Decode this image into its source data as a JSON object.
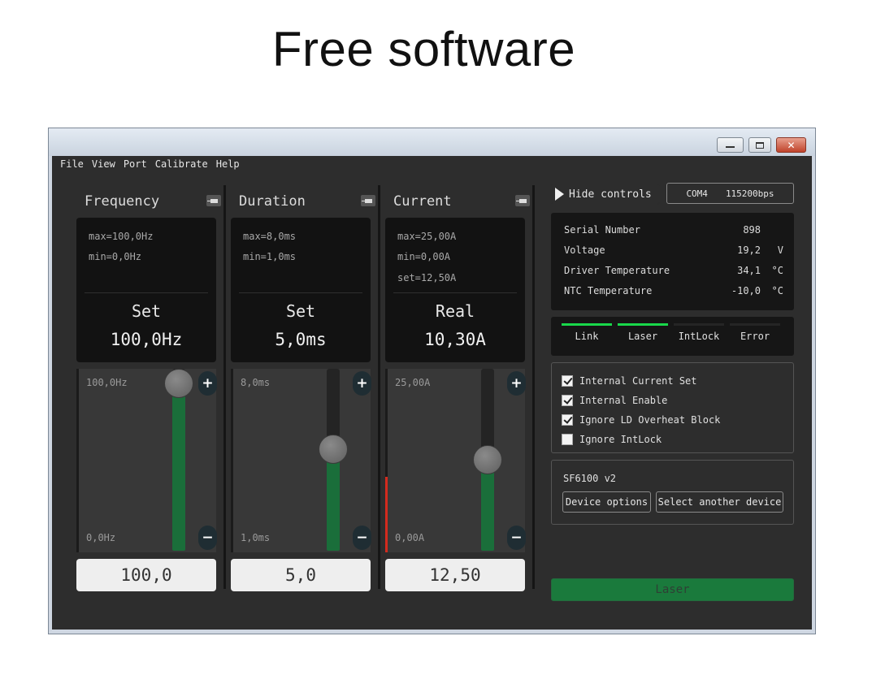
{
  "slide": {
    "title": "Free software"
  },
  "window": {
    "controls": {
      "minimize": "minimize",
      "maximize": "maximize",
      "close": "✕"
    }
  },
  "menu": [
    "File",
    "View",
    "Port",
    "Calibrate",
    "Help"
  ],
  "panels": [
    {
      "title": "Frequency",
      "info": [
        "max=100,0Hz",
        "min=0,0Hz"
      ],
      "mode": "Set",
      "display": "100,0Hz",
      "slider_max": "100,0Hz",
      "slider_min": "0,0Hz",
      "level": 1.0,
      "field": "100,0"
    },
    {
      "title": "Duration",
      "info": [
        "max=8,0ms",
        "min=1,0ms"
      ],
      "mode": "Set",
      "display": "5,0ms",
      "slider_max": "8,0ms",
      "slider_min": "1,0ms",
      "level": 0.571,
      "field": "5,0"
    },
    {
      "title": "Current",
      "info": [
        "max=25,00A",
        "min=0,00A",
        "set=12,50A"
      ],
      "mode": "Real",
      "display": "10,30A",
      "slider_max": "25,00A",
      "slider_min": "0,00A",
      "level": 0.5,
      "actual_level": 0.412,
      "field": "12,50"
    }
  ],
  "controls": {
    "hide_label": "Hide controls",
    "port": "COM4",
    "baud": "115200bps"
  },
  "status": [
    {
      "label": "Serial Number",
      "value": "898",
      "unit": ""
    },
    {
      "label": "Voltage",
      "value": "19,2",
      "unit": "V"
    },
    {
      "label": "Driver Temperature",
      "value": "34,1",
      "unit": "°C"
    },
    {
      "label": "NTC Temperature",
      "value": "-10,0",
      "unit": "°C"
    }
  ],
  "indicators": [
    {
      "label": "Link",
      "on": true
    },
    {
      "label": "Laser",
      "on": true
    },
    {
      "label": "IntLock",
      "on": false
    },
    {
      "label": "Error",
      "on": false
    }
  ],
  "options": [
    {
      "label": "Internal Current Set",
      "checked": true
    },
    {
      "label": "Internal Enable",
      "checked": true
    },
    {
      "label": "Ignore LD Overheat Block",
      "checked": true
    },
    {
      "label": "Ignore IntLock",
      "checked": false
    }
  ],
  "device": {
    "name": "SF6100 v2",
    "options_label": "Device options",
    "select_label": "Select another device"
  },
  "laser_button": "Laser",
  "colors": {
    "indicator_on": "#19d84a",
    "slider_fill": "#1a6e3a",
    "actual_bar": "#d42b1e",
    "laser_button": "#1a7a3c"
  }
}
